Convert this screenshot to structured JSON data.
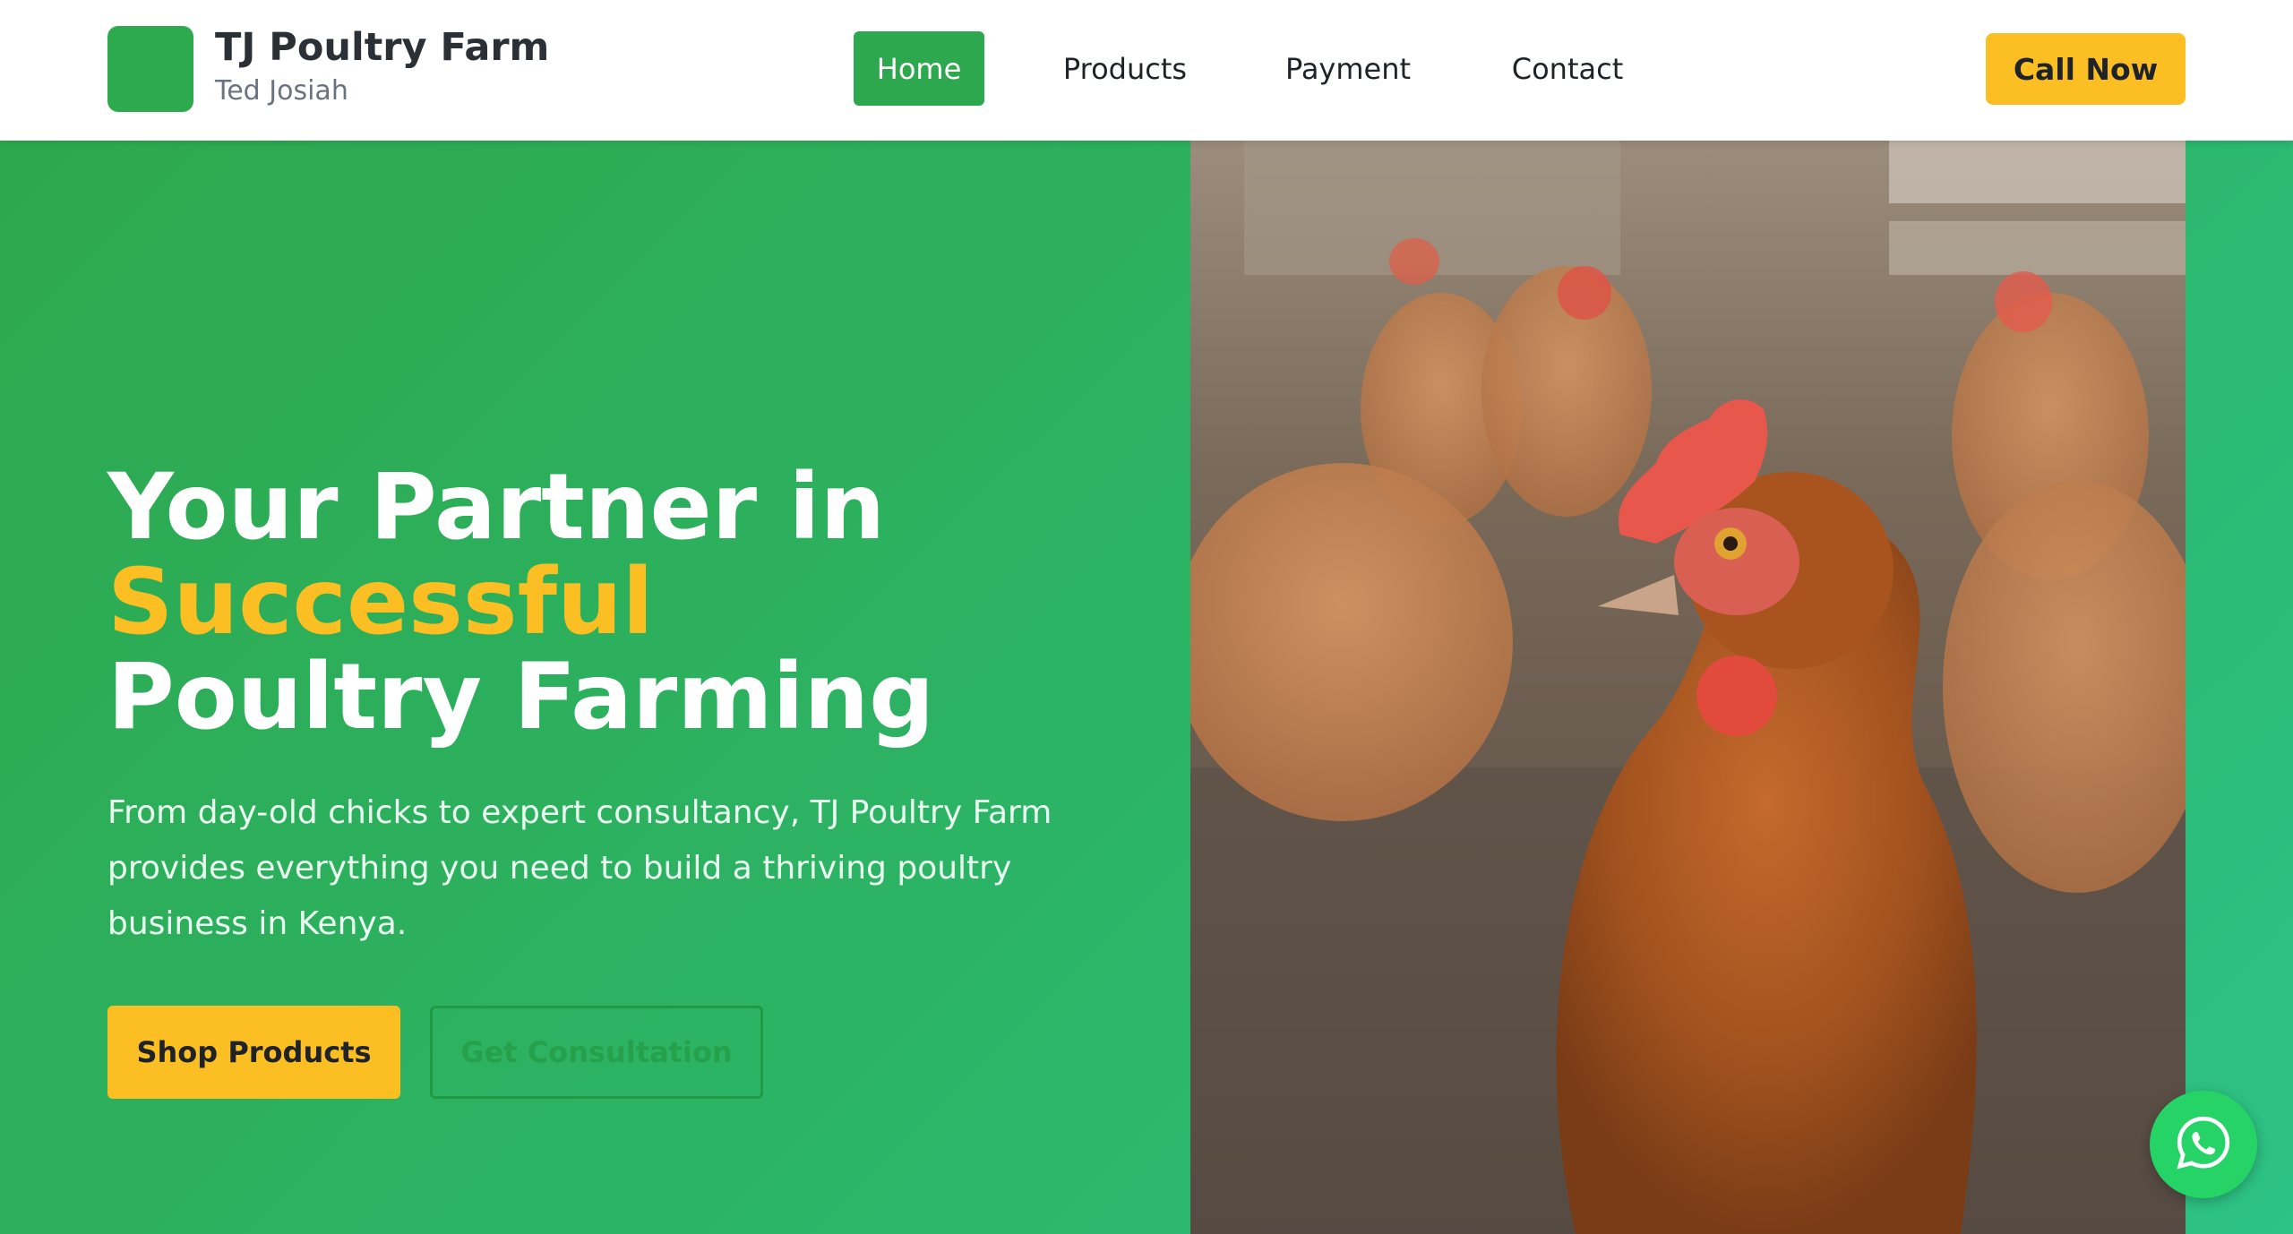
{
  "brand": {
    "name": "TJ Poultry Farm",
    "owner": "Ted Josiah",
    "logo_color": "#2eaa4e"
  },
  "nav": {
    "items": [
      {
        "label": "Home",
        "active": true
      },
      {
        "label": "Products",
        "active": false
      },
      {
        "label": "Payment",
        "active": false
      },
      {
        "label": "Contact",
        "active": false
      }
    ],
    "call_label": "Call Now"
  },
  "hero": {
    "title_line1": "Your Partner in",
    "title_accent": "Successful",
    "title_line3": "Poultry Farming",
    "description": "From day-old chicks to expert consultancy, TJ Poultry Farm provides everything you need to build a thriving poultry business in Kenya.",
    "primary_cta": "Shop Products",
    "secondary_cta": "Get Consultation",
    "image_subject": "hens-in-farmyard-photo"
  },
  "floating": {
    "whatsapp_icon": "whatsapp-icon"
  },
  "colors": {
    "primary_green": "#2ea84e",
    "accent_yellow": "#fbbf24",
    "whatsapp_green": "#25d366"
  }
}
